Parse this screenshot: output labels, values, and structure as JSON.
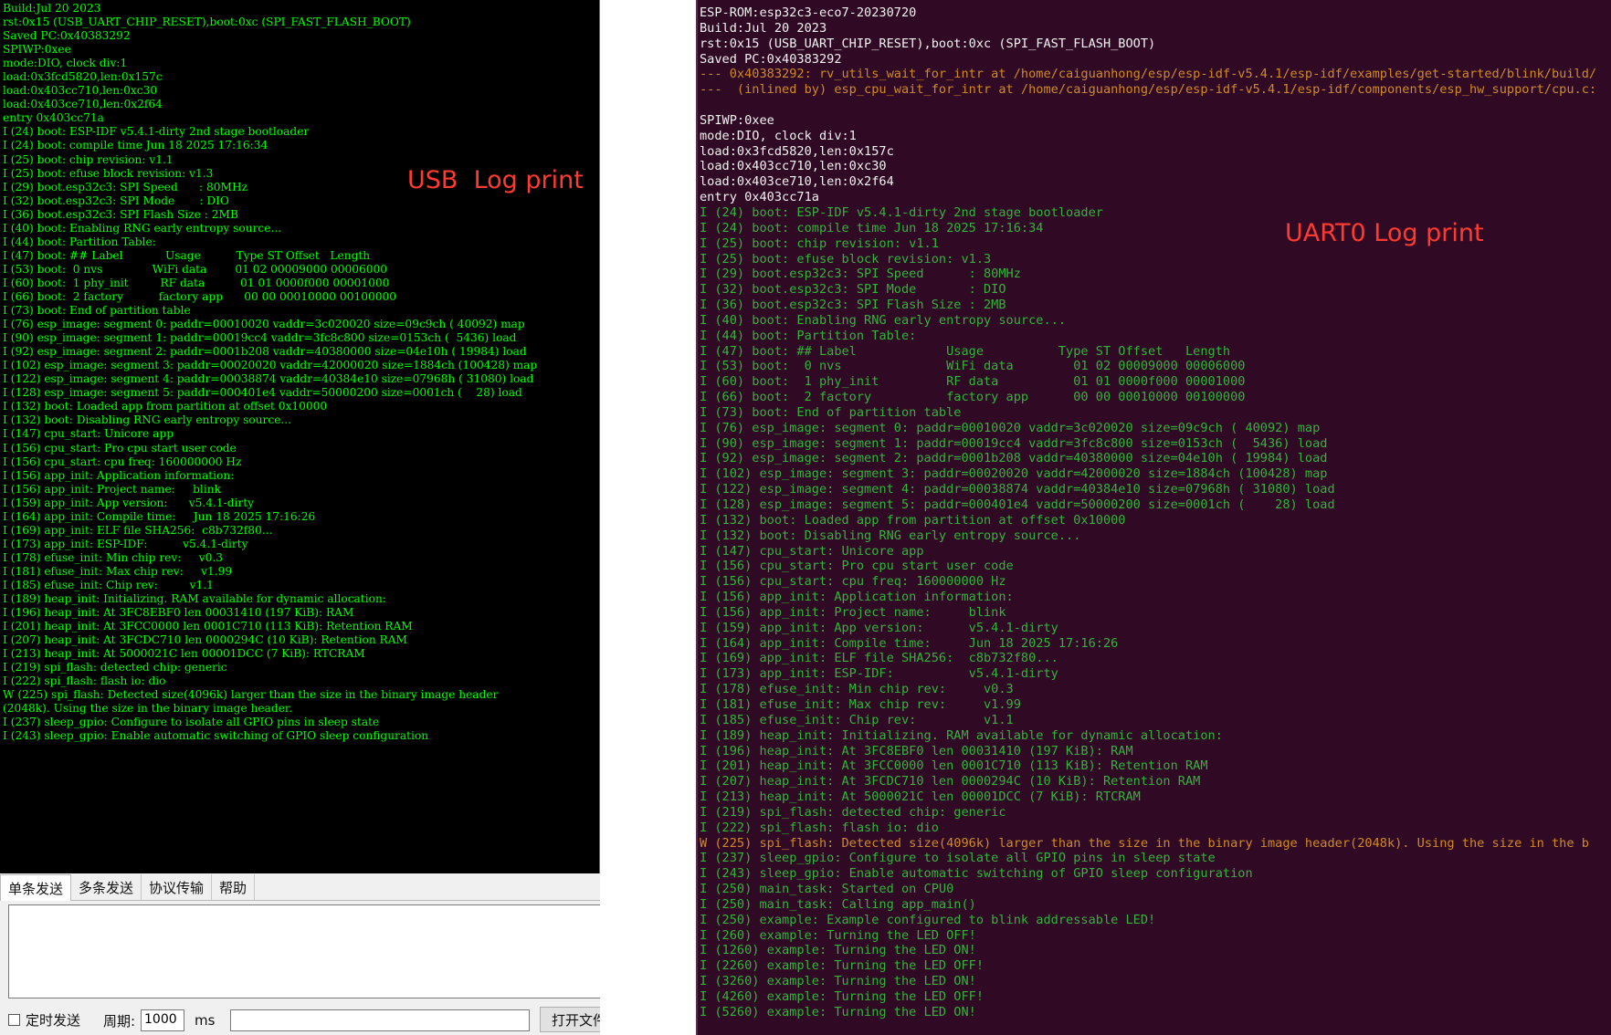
{
  "usb_panel": {
    "annotation": "USB  Log print",
    "lines": [
      "Build:Jul 20 2023",
      "rst:0x15 (USB_UART_CHIP_RESET),boot:0xc (SPI_FAST_FLASH_BOOT)",
      "Saved PC:0x40383292",
      "SPIWP:0xee",
      "mode:DIO, clock div:1",
      "load:0x3fcd5820,len:0x157c",
      "load:0x403cc710,len:0xc30",
      "load:0x403ce710,len:0x2f64",
      "entry 0x403cc71a",
      "I (24) boot: ESP-IDF v5.4.1-dirty 2nd stage bootloader",
      "I (24) boot: compile time Jun 18 2025 17:16:34",
      "I (25) boot: chip revision: v1.1",
      "I (25) boot: efuse block revision: v1.3",
      "I (29) boot.esp32c3: SPI Speed      : 80MHz",
      "I (32) boot.esp32c3: SPI Mode       : DIO",
      "I (36) boot.esp32c3: SPI Flash Size : 2MB",
      "I (40) boot: Enabling RNG early entropy source...",
      "I (44) boot: Partition Table:",
      "I (47) boot: ## Label            Usage          Type ST Offset   Length",
      "I (53) boot:  0 nvs              WiFi data        01 02 00009000 00006000",
      "I (60) boot:  1 phy_init         RF data          01 01 0000f000 00001000",
      "I (66) boot:  2 factory          factory app      00 00 00010000 00100000",
      "I (73) boot: End of partition table",
      "I (76) esp_image: segment 0: paddr=00010020 vaddr=3c020020 size=09c9ch ( 40092) map",
      "I (90) esp_image: segment 1: paddr=00019cc4 vaddr=3fc8c800 size=0153ch (  5436) load",
      "I (92) esp_image: segment 2: paddr=0001b208 vaddr=40380000 size=04e10h ( 19984) load",
      "I (102) esp_image: segment 3: paddr=00020020 vaddr=42000020 size=1884ch (100428) map",
      "I (122) esp_image: segment 4: paddr=00038874 vaddr=40384e10 size=07968h ( 31080) load",
      "I (128) esp_image: segment 5: paddr=000401e4 vaddr=50000200 size=0001ch (    28) load",
      "I (132) boot: Loaded app from partition at offset 0x10000",
      "I (132) boot: Disabling RNG early entropy source...",
      "I (147) cpu_start: Unicore app",
      "I (156) cpu_start: Pro cpu start user code",
      "I (156) cpu_start: cpu freq: 160000000 Hz",
      "I (156) app_init: Application information:",
      "I (156) app_init: Project name:     blink",
      "I (159) app_init: App version:      v5.4.1-dirty",
      "I (164) app_init: Compile time:     Jun 18 2025 17:16:26",
      "I (169) app_init: ELF file SHA256:  c8b732f80...",
      "I (173) app_init: ESP-IDF:          v5.4.1-dirty",
      "I (178) efuse_init: Min chip rev:     v0.3",
      "I (181) efuse_init: Max chip rev:     v1.99",
      "I (185) efuse_init: Chip rev:         v1.1",
      "I (189) heap_init: Initializing. RAM available for dynamic allocation:",
      "I (196) heap_init: At 3FC8EBF0 len 00031410 (197 KiB): RAM",
      "I (201) heap_init: At 3FCC0000 len 0001C710 (113 KiB): Retention RAM",
      "I (207) heap_init: At 3FCDC710 len 0000294C (10 KiB): Retention RAM",
      "I (213) heap_init: At 5000021C len 00001DCC (7 KiB): RTCRAM",
      "I (219) spi_flash: detected chip: generic",
      "I (222) spi_flash: flash io: dio",
      "W (225) spi_flash: Detected size(4096k) larger than the size in the binary image header",
      "(2048k). Using the size in the binary image header.",
      "I (237) sleep_gpio: Configure to isolate all GPIO pins in sleep state",
      "I (243) sleep_gpio: Enable automatic switching of GPIO sleep configuration"
    ]
  },
  "send_tabs": [
    "单条发送",
    "多条发送",
    "协议传输",
    "帮助"
  ],
  "bottom_bar": {
    "timed_send_label": "定时发送",
    "period_label": "周期:",
    "period_value": "1000",
    "unit_label": "ms",
    "open_file_label": "打开文件"
  },
  "uart_panel": {
    "annotation": "UART0 Log print",
    "lines": [
      {
        "text": "ESP-ROM:esp32c3-eco7-20230720",
        "style": "white"
      },
      {
        "text": "Build:Jul 20 2023",
        "style": "white"
      },
      {
        "text": "rst:0x15 (USB_UART_CHIP_RESET),boot:0xc (SPI_FAST_FLASH_BOOT)",
        "style": "white"
      },
      {
        "text": "Saved PC:0x40383292",
        "style": "white"
      },
      {
        "text": "--- 0x40383292: rv_utils_wait_for_intr at /home/caiguanhong/esp/esp-idf-v5.4.1/esp-idf/examples/get-started/blink/build/",
        "style": "warn"
      },
      {
        "text": "---  (inlined by) esp_cpu_wait_for_intr at /home/caiguanhong/esp/esp-idf-v5.4.1/esp-idf/components/esp_hw_support/cpu.c:",
        "style": "warn"
      },
      {
        "text": "",
        "style": "blank"
      },
      {
        "text": "SPIWP:0xee",
        "style": "white"
      },
      {
        "text": "mode:DIO, clock div:1",
        "style": "white"
      },
      {
        "text": "load:0x3fcd5820,len:0x157c",
        "style": "white"
      },
      {
        "text": "load:0x403cc710,len:0xc30",
        "style": "white"
      },
      {
        "text": "load:0x403ce710,len:0x2f64",
        "style": "white"
      },
      {
        "text": "entry 0x403cc71a",
        "style": "white"
      },
      {
        "text": "I (24) boot: ESP-IDF v5.4.1-dirty 2nd stage bootloader",
        "style": "info"
      },
      {
        "text": "I (24) boot: compile time Jun 18 2025 17:16:34",
        "style": "info"
      },
      {
        "text": "I (25) boot: chip revision: v1.1",
        "style": "info"
      },
      {
        "text": "I (25) boot: efuse block revision: v1.3",
        "style": "info"
      },
      {
        "text": "I (29) boot.esp32c3: SPI Speed      : 80MHz",
        "style": "info"
      },
      {
        "text": "I (32) boot.esp32c3: SPI Mode       : DIO",
        "style": "info"
      },
      {
        "text": "I (36) boot.esp32c3: SPI Flash Size : 2MB",
        "style": "info"
      },
      {
        "text": "I (40) boot: Enabling RNG early entropy source...",
        "style": "info"
      },
      {
        "text": "I (44) boot: Partition Table:",
        "style": "info"
      },
      {
        "text": "I (47) boot: ## Label            Usage          Type ST Offset   Length",
        "style": "info"
      },
      {
        "text": "I (53) boot:  0 nvs              WiFi data        01 02 00009000 00006000",
        "style": "info"
      },
      {
        "text": "I (60) boot:  1 phy_init         RF data          01 01 0000f000 00001000",
        "style": "info"
      },
      {
        "text": "I (66) boot:  2 factory          factory app      00 00 00010000 00100000",
        "style": "info"
      },
      {
        "text": "I (73) boot: End of partition table",
        "style": "info"
      },
      {
        "text": "I (76) esp_image: segment 0: paddr=00010020 vaddr=3c020020 size=09c9ch ( 40092) map",
        "style": "info"
      },
      {
        "text": "I (90) esp_image: segment 1: paddr=00019cc4 vaddr=3fc8c800 size=0153ch (  5436) load",
        "style": "info"
      },
      {
        "text": "I (92) esp_image: segment 2: paddr=0001b208 vaddr=40380000 size=04e10h ( 19984) load",
        "style": "info"
      },
      {
        "text": "I (102) esp_image: segment 3: paddr=00020020 vaddr=42000020 size=1884ch (100428) map",
        "style": "info"
      },
      {
        "text": "I (122) esp_image: segment 4: paddr=00038874 vaddr=40384e10 size=07968h ( 31080) load",
        "style": "info"
      },
      {
        "text": "I (128) esp_image: segment 5: paddr=000401e4 vaddr=50000200 size=0001ch (    28) load",
        "style": "info"
      },
      {
        "text": "I (132) boot: Loaded app from partition at offset 0x10000",
        "style": "info"
      },
      {
        "text": "I (132) boot: Disabling RNG early entropy source...",
        "style": "info"
      },
      {
        "text": "I (147) cpu_start: Unicore app",
        "style": "info"
      },
      {
        "text": "I (156) cpu_start: Pro cpu start user code",
        "style": "info"
      },
      {
        "text": "I (156) cpu_start: cpu freq: 160000000 Hz",
        "style": "info"
      },
      {
        "text": "I (156) app_init: Application information:",
        "style": "info"
      },
      {
        "text": "I (156) app_init: Project name:     blink",
        "style": "info"
      },
      {
        "text": "I (159) app_init: App version:      v5.4.1-dirty",
        "style": "info"
      },
      {
        "text": "I (164) app_init: Compile time:     Jun 18 2025 17:16:26",
        "style": "info"
      },
      {
        "text": "I (169) app_init: ELF file SHA256:  c8b732f80...",
        "style": "info"
      },
      {
        "text": "I (173) app_init: ESP-IDF:          v5.4.1-dirty",
        "style": "info"
      },
      {
        "text": "I (178) efuse_init: Min chip rev:     v0.3",
        "style": "info"
      },
      {
        "text": "I (181) efuse_init: Max chip rev:     v1.99",
        "style": "info"
      },
      {
        "text": "I (185) efuse_init: Chip rev:         v1.1",
        "style": "info"
      },
      {
        "text": "I (189) heap_init: Initializing. RAM available for dynamic allocation:",
        "style": "info"
      },
      {
        "text": "I (196) heap_init: At 3FC8EBF0 len 00031410 (197 KiB): RAM",
        "style": "info"
      },
      {
        "text": "I (201) heap_init: At 3FCC0000 len 0001C710 (113 KiB): Retention RAM",
        "style": "info"
      },
      {
        "text": "I (207) heap_init: At 3FCDC710 len 0000294C (10 KiB): Retention RAM",
        "style": "info"
      },
      {
        "text": "I (213) heap_init: At 5000021C len 00001DCC (7 KiB): RTCRAM",
        "style": "info"
      },
      {
        "text": "I (219) spi_flash: detected chip: generic",
        "style": "info"
      },
      {
        "text": "I (222) spi_flash: flash io: dio",
        "style": "info"
      },
      {
        "text": "W (225) spi_flash: Detected size(4096k) larger than the size in the binary image header(2048k). Using the size in the b",
        "style": "warn"
      },
      {
        "text": "I (237) sleep_gpio: Configure to isolate all GPIO pins in sleep state",
        "style": "info"
      },
      {
        "text": "I (243) sleep_gpio: Enable automatic switching of GPIO sleep configuration",
        "style": "info"
      },
      {
        "text": "I (250) main_task: Started on CPU0",
        "style": "info"
      },
      {
        "text": "I (250) main_task: Calling app_main()",
        "style": "info"
      },
      {
        "text": "I (250) example: Example configured to blink addressable LED!",
        "style": "info"
      },
      {
        "text": "I (260) example: Turning the LED OFF!",
        "style": "info"
      },
      {
        "text": "I (1260) example: Turning the LED ON!",
        "style": "info"
      },
      {
        "text": "I (2260) example: Turning the LED OFF!",
        "style": "info"
      },
      {
        "text": "I (3260) example: Turning the LED ON!",
        "style": "info"
      },
      {
        "text": "I (4260) example: Turning the LED OFF!",
        "style": "info"
      },
      {
        "text": "I (5260) example: Turning the LED ON!",
        "style": "info"
      }
    ]
  },
  "colors": {
    "usb_log_text": "#00ff00",
    "usb_log_background": "#000000",
    "terminal_background": "#300a24",
    "uart_info_text": "#32b43a",
    "uart_warn_text": "#d08a25",
    "annotation_text": "#ff3b30"
  }
}
